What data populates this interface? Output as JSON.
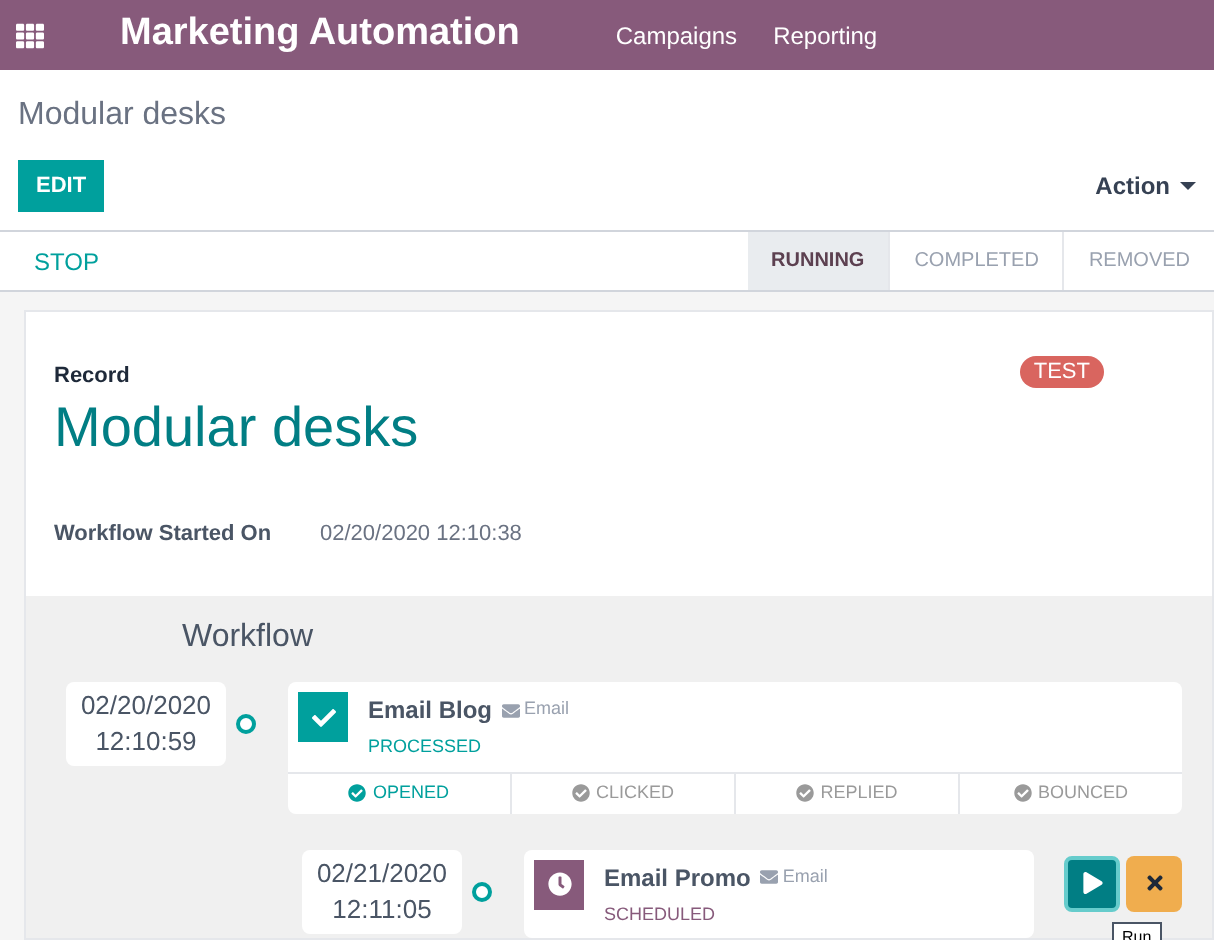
{
  "navbar": {
    "app_title": "Marketing Automation",
    "menu": [
      "Campaigns",
      "Reporting"
    ]
  },
  "breadcrumb": "Modular desks",
  "buttons": {
    "edit": "EDIT",
    "action": "Action"
  },
  "statusbar": {
    "stop": "STOP",
    "stages": [
      {
        "label": "RUNNING",
        "selected": true
      },
      {
        "label": "COMPLETED",
        "selected": false
      },
      {
        "label": "REMOVED",
        "selected": false
      }
    ]
  },
  "record": {
    "label": "Record",
    "badge": "TEST",
    "name": "Modular desks",
    "field_label": "Workflow Started On",
    "field_value": "02/20/2020 12:10:38"
  },
  "workflow": {
    "title": "Workflow",
    "activities": [
      {
        "date": "02/20/2020",
        "time": "12:10:59",
        "name": "Email Blog",
        "type": "Email",
        "state": "PROCESSED",
        "kind": "done",
        "trackers": [
          {
            "label": "OPENED",
            "on": true
          },
          {
            "label": "CLICKED",
            "on": false
          },
          {
            "label": "REPLIED",
            "on": false
          },
          {
            "label": "BOUNCED",
            "on": false
          }
        ]
      },
      {
        "date": "02/21/2020",
        "time": "12:11:05",
        "name": "Email Promo",
        "type": "Email",
        "state": "SCHEDULED",
        "kind": "scheduled",
        "tooltip": "Run"
      }
    ]
  }
}
